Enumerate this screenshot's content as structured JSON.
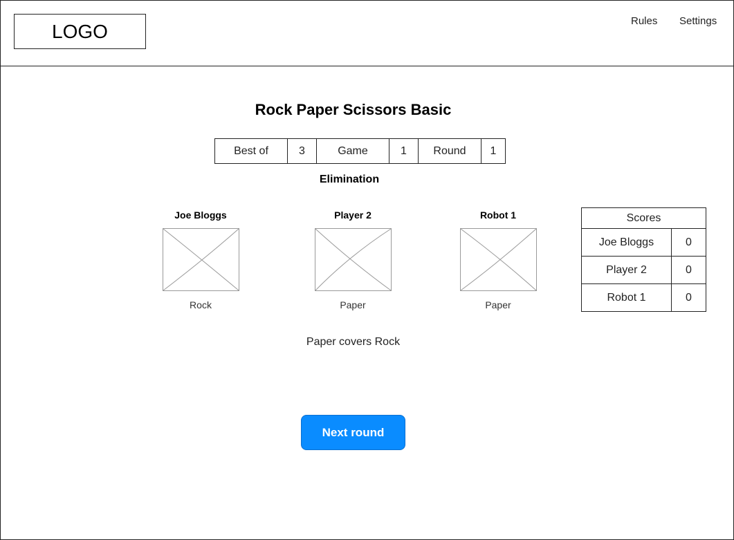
{
  "header": {
    "logo": "LOGO",
    "nav": {
      "rules": "Rules",
      "settings": "Settings"
    }
  },
  "main": {
    "title": "Rock Paper Scissors Basic",
    "info": {
      "best_of_label": "Best of",
      "best_of_value": "3",
      "game_label": "Game",
      "game_value": "1",
      "round_label": "Round",
      "round_value": "1"
    },
    "mode": "Elimination",
    "players": [
      {
        "name": "Joe Bloggs",
        "choice": "Rock"
      },
      {
        "name": "Player 2",
        "choice": "Paper"
      },
      {
        "name": "Robot 1",
        "choice": "Paper"
      }
    ],
    "result": "Paper covers Rock",
    "next_button": "Next round"
  },
  "scores": {
    "header": "Scores",
    "rows": [
      {
        "name": "Joe Bloggs",
        "score": "0"
      },
      {
        "name": "Player 2",
        "score": "0"
      },
      {
        "name": "Robot 1",
        "score": "0"
      }
    ]
  },
  "colors": {
    "accent": "#0a8cff",
    "border": "#222222"
  }
}
